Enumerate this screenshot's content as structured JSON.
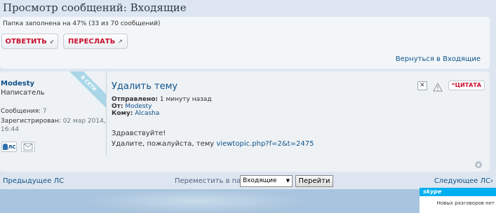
{
  "page": {
    "title": "Просмотр сообщений: Входящие",
    "capacity_text": "Папка заполнена на 47% (33 из 70 сообщений)",
    "capacity_percent": 47
  },
  "toolbar": {
    "reply_label": "ОТВЕТИТЬ",
    "forward_label": "ПЕРЕСЛАТЬ",
    "back_link": "Вернуться в Входящие"
  },
  "author": {
    "name": "Modesty",
    "rank": "Написатель",
    "online_badge": "В СЕТИ",
    "posts_label": "Сообщения:",
    "posts_value": "7",
    "joined_label": "Зарегистрирован:",
    "joined_value": "02 мар 2014, 16:44",
    "pm_label": "ЛС"
  },
  "message": {
    "subject": "Удалить тему",
    "sent_label": "Отправлено:",
    "sent_value": "1 минуту назад",
    "from_label": "От:",
    "from_value": "Modesty",
    "to_label": "Кому:",
    "to_value": "Alcasha",
    "greeting": "Здравствуйте!",
    "body_text": "Удалите, пожалуйста, тему",
    "body_link": "viewtopic.php?f=2&t=2475",
    "quote_label": "ЦИТАТА"
  },
  "bottom": {
    "prev_link": "Предыдущее ЛС",
    "move_label": "Переместить в папку:",
    "folder_selected": "Входящие",
    "go_label": "Перейти",
    "next_link": "Следующее ЛС"
  },
  "skype": {
    "brand": "skype",
    "status_text": "Новых разговоров нет"
  },
  "colors": {
    "link": "#105289",
    "accent_red": "#c8102e",
    "skype_blue": "#00aff0"
  }
}
